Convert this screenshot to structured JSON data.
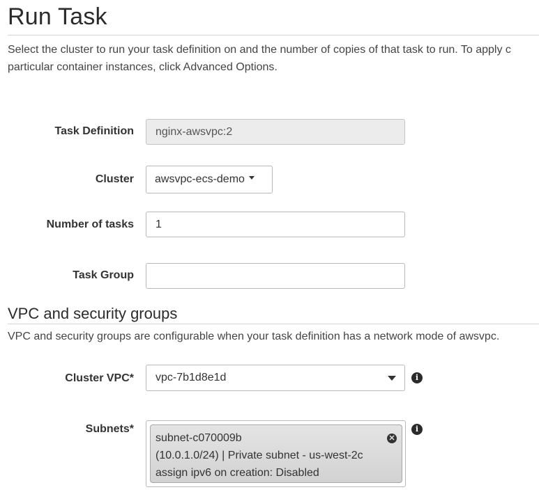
{
  "page": {
    "title": "Run Task",
    "intro_line1": "Select the cluster to run your task definition on and the number of copies of that task to run. To apply c",
    "intro_line2": "particular container instances, click Advanced Options."
  },
  "form": {
    "task_definition": {
      "label": "Task Definition",
      "value": "nginx-awsvpc:2"
    },
    "cluster": {
      "label": "Cluster",
      "value": "awsvpc-ecs-demo"
    },
    "number_of_tasks": {
      "label": "Number of tasks",
      "value": "1"
    },
    "task_group": {
      "label": "Task Group",
      "value": ""
    }
  },
  "vpc_section": {
    "title": "VPC and security groups",
    "description": "VPC and security groups are configurable when your task definition has a network mode of awsvpc.",
    "cluster_vpc": {
      "label": "Cluster VPC*",
      "value": "vpc-7b1d8e1d"
    },
    "subnets": {
      "label": "Subnets*",
      "selected": {
        "line1": "subnet-c070009b",
        "line2": "(10.0.1.0/24) | Private subnet - us-west-2c",
        "line3": "assign ipv6 on creation: Disabled"
      }
    }
  },
  "icons": {
    "info": "i",
    "remove": "✕"
  }
}
